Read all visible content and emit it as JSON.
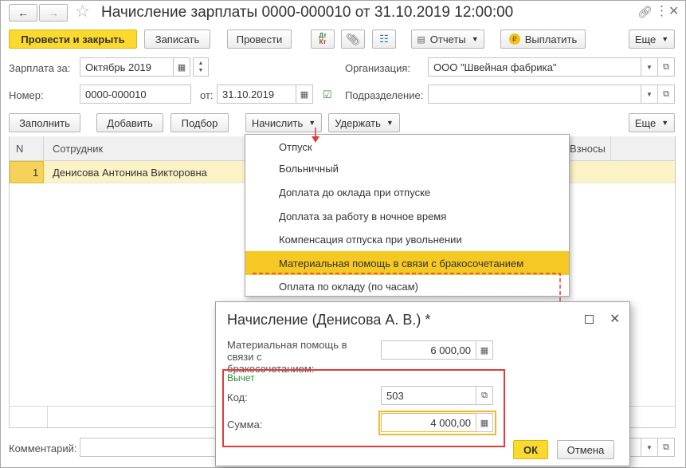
{
  "window": {
    "title": "Начисление зарплаты 0000-000010 от 31.10.2019 12:00:00"
  },
  "toolbar": {
    "post_close": "Провести и закрыть",
    "save": "Записать",
    "post": "Провести",
    "dt_kt_label": "Дт Кт",
    "reports": "Отчеты",
    "pay": "Выплатить",
    "more": "Еще"
  },
  "form": {
    "salary_for_label": "Зарплата за:",
    "salary_for_value": "Октябрь 2019",
    "number_label": "Номер:",
    "number_value": "0000-000010",
    "date_label": "от:",
    "date_value": "31.10.2019",
    "org_label": "Организация:",
    "org_value": "ООО \"Швейная фабрика\"",
    "dept_label": "Подразделение:",
    "dept_value": ""
  },
  "table_toolbar": {
    "fill": "Заполнить",
    "add": "Добавить",
    "select": "Подбор",
    "accrue": "Начислить",
    "withhold": "Удержать",
    "more": "Еще"
  },
  "table": {
    "columns": [
      "N",
      "Сотрудник",
      "Взносы"
    ],
    "rows": [
      {
        "n": "1",
        "employee": "Денисова Антонина Викторовна"
      }
    ]
  },
  "dropdown_menu": {
    "items": [
      "Отпуск",
      "Больничный",
      "Доплата до оклада при отпуске",
      "Доплата за работу в ночное время",
      "Компенсация отпуска при увольнении",
      "Материальная помощь в связи с бракосочетанием",
      "Оплата по окладу (по часам)"
    ],
    "selected_index": 5
  },
  "comment": {
    "label": "Комментарий:",
    "value": ""
  },
  "dialog": {
    "title": "Начисление (Денисова А. В.) *",
    "aid_label": "Материальная помощь в связи с бракосочетанием:",
    "aid_value": "6 000,00",
    "deduction_title": "Вычет",
    "code_label": "Код:",
    "code_value": "503",
    "sum_label": "Сумма:",
    "sum_value": "4 000,00",
    "ok": "ОК",
    "cancel": "Отмена"
  },
  "colors": {
    "accent_yellow": "#fbd92f",
    "menu_highlight": "#f5c823",
    "row_highlight": "#fbf2c6",
    "annotation_red": "#e03c3c",
    "focus_orange": "#f2b632",
    "deduction_green": "#2e8b2e"
  }
}
